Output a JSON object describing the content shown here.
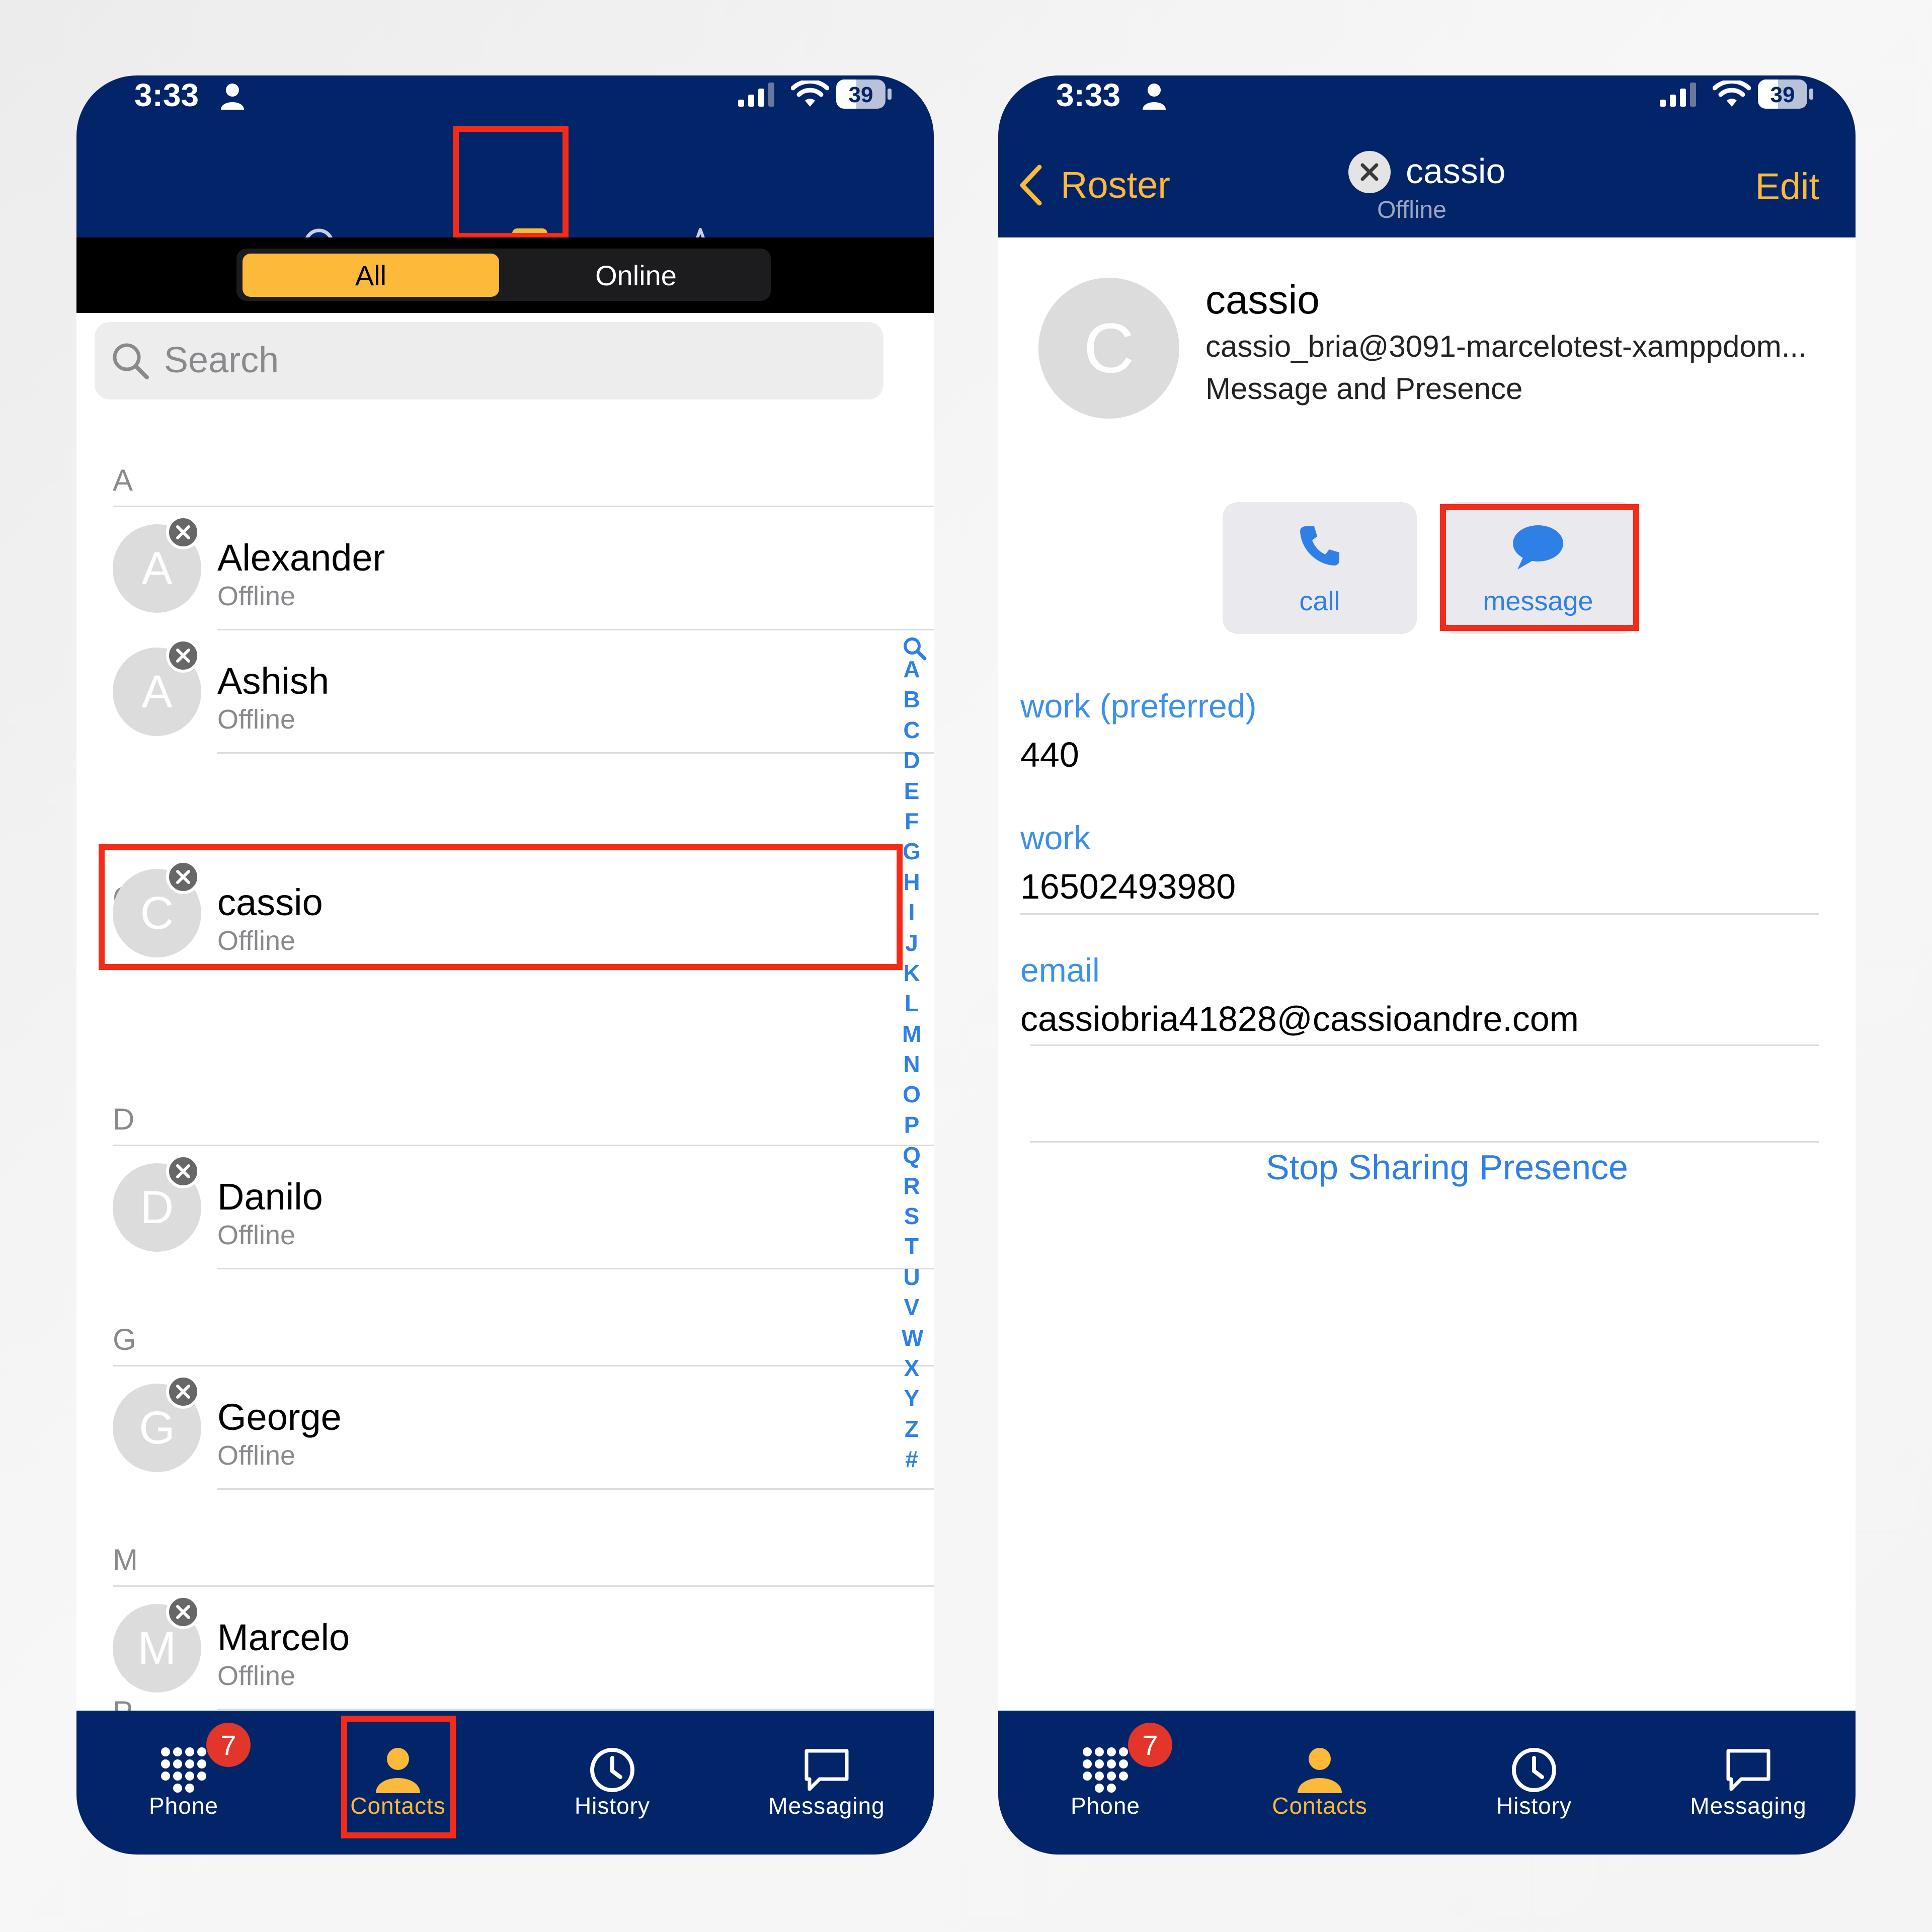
{
  "left": {
    "status": {
      "time": "3:33",
      "battery": "39"
    },
    "segments": {
      "all": "All",
      "online": "Online"
    },
    "search": {
      "placeholder": "Search"
    },
    "sections": [
      "A",
      "C",
      "D",
      "G",
      "M",
      "P"
    ],
    "contacts": [
      {
        "initial": "A",
        "name": "Alexander",
        "status": "Offline"
      },
      {
        "initial": "A",
        "name": "Ashish",
        "status": "Offline"
      },
      {
        "initial": "C",
        "name": "cassio",
        "status": "Offline"
      },
      {
        "initial": "D",
        "name": "Danilo",
        "status": "Offline"
      },
      {
        "initial": "G",
        "name": "George",
        "status": "Offline"
      },
      {
        "initial": "M",
        "name": "Marcelo",
        "status": "Offline"
      }
    ],
    "index": [
      "A",
      "B",
      "C",
      "D",
      "E",
      "F",
      "G",
      "H",
      "I",
      "J",
      "K",
      "L",
      "M",
      "N",
      "O",
      "P",
      "Q",
      "R",
      "S",
      "T",
      "U",
      "V",
      "W",
      "X",
      "Y",
      "Z",
      "#"
    ],
    "tabs": [
      {
        "label": "Phone",
        "icon": "keypad-icon",
        "badge": "7"
      },
      {
        "label": "Contacts",
        "icon": "person-icon",
        "active": true
      },
      {
        "label": "History",
        "icon": "clock-icon"
      },
      {
        "label": "Messaging",
        "icon": "chat-icon"
      }
    ]
  },
  "right": {
    "status": {
      "time": "3:33",
      "battery": "39"
    },
    "nav": {
      "back": "Roster",
      "title": "cassio",
      "subtitle": "Offline",
      "edit": "Edit"
    },
    "profile": {
      "initial": "C",
      "name": "cassio",
      "address": "cassio_bria@3091-marcelotest-xamppdom...",
      "type": "Message and Presence"
    },
    "actions": {
      "call": "call",
      "message": "message"
    },
    "fields": [
      {
        "label": "work (preferred)",
        "value": "440"
      },
      {
        "label": "work",
        "value": "16502493980"
      },
      {
        "label": "email",
        "value": "cassiobria41828@cassioandre.com"
      }
    ],
    "stop_sharing": "Stop Sharing Presence",
    "tabs": [
      {
        "label": "Phone",
        "icon": "keypad-icon",
        "badge": "7"
      },
      {
        "label": "Contacts",
        "icon": "person-icon",
        "active": true
      },
      {
        "label": "History",
        "icon": "clock-icon"
      },
      {
        "label": "Messaging",
        "icon": "chat-icon"
      }
    ]
  },
  "colors": {
    "navy": "#02256a",
    "accent": "#fcb93a",
    "link_blue": "#2f80e6",
    "highlight_red": "#f32b18",
    "badge_red": "#e2362a"
  }
}
